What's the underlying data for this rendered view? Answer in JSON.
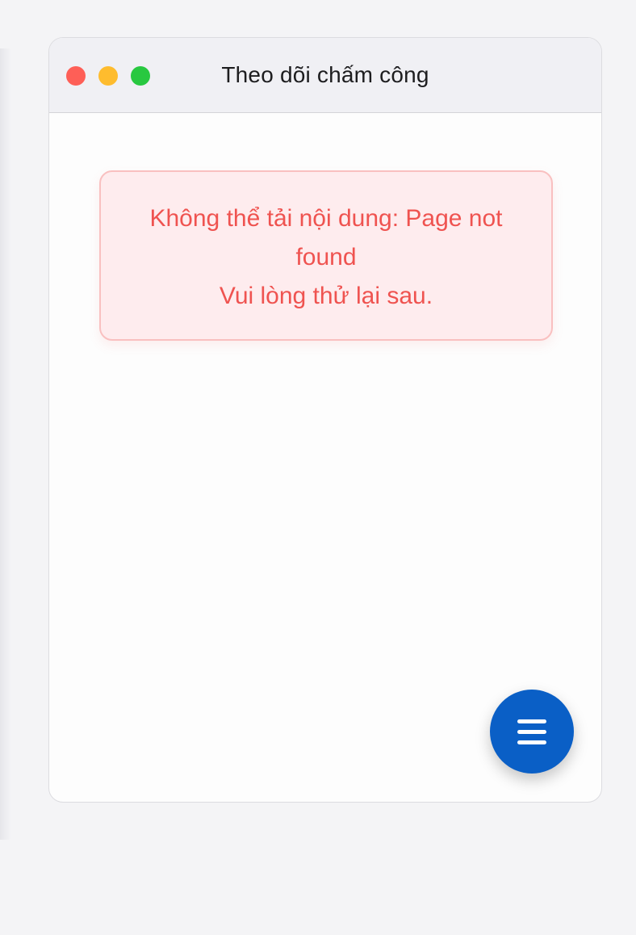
{
  "window": {
    "title": "Theo dõi chấm công"
  },
  "error": {
    "message": "Không thể tải nội dung: Page not found",
    "hint": "Vui lòng thử lại sau."
  },
  "fab": {
    "icon": "menu-icon"
  },
  "colors": {
    "fab": "#0a5fc6",
    "error_text": "#ef5350",
    "error_bg": "#feecee",
    "error_border": "#f9c0c0",
    "close": "#fe5f57",
    "minimize": "#febc2e",
    "zoom": "#28c840"
  }
}
